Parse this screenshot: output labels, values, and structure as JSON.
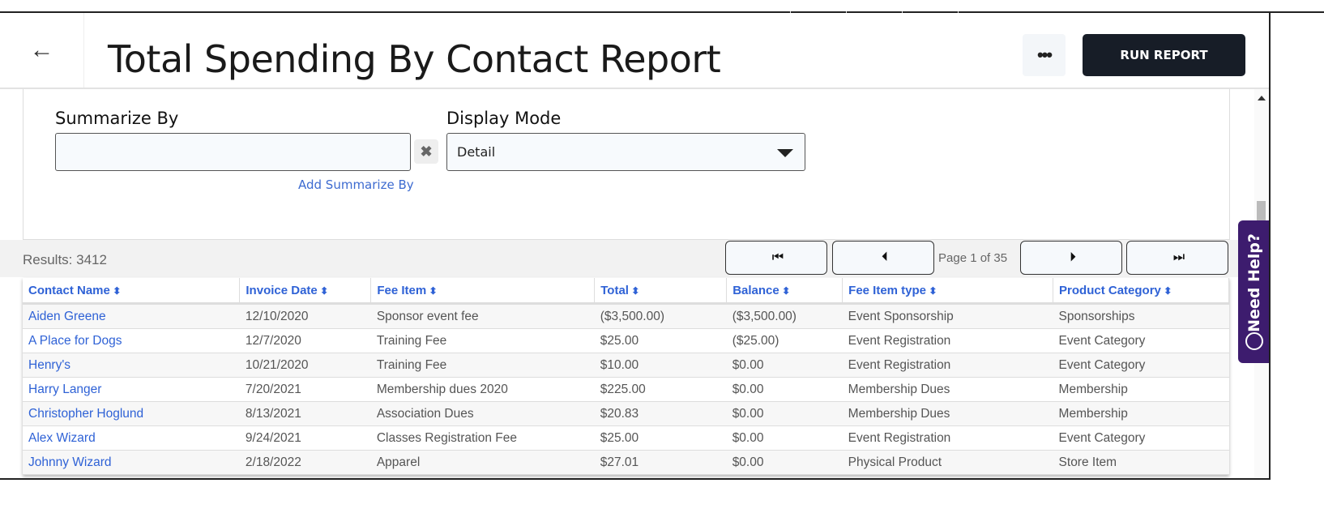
{
  "header": {
    "title": "Total Spending By Contact Report",
    "run_label": "RUN REPORT",
    "more_label": "•••",
    "back_icon": "←"
  },
  "form": {
    "summarize_label": "Summarize By",
    "summarize_value": "",
    "clear_icon": "✖",
    "add_summarize": "Add Summarize By",
    "display_label": "Display Mode",
    "display_value": "Detail"
  },
  "results": {
    "text": "Results: 3412",
    "page_info": "Page 1 of 35",
    "first": "⏮",
    "prev": "⏴",
    "next": "⏵",
    "last": "⏭"
  },
  "help": {
    "label": "Need Help?"
  },
  "table": {
    "columns": [
      "Contact Name",
      "Invoice Date",
      "Fee Item",
      "Total",
      "Balance",
      "Fee Item type",
      "Product Category"
    ],
    "rows": [
      [
        "Aiden Greene",
        "12/10/2020",
        "Sponsor event fee",
        "($3,500.00)",
        "($3,500.00)",
        "Event Sponsorship",
        "Sponsorships"
      ],
      [
        "A Place for Dogs",
        "12/7/2020",
        "Training Fee",
        "$25.00",
        "($25.00)",
        "Event Registration",
        "Event Category"
      ],
      [
        "Henry's",
        "10/21/2020",
        "Training Fee",
        "$10.00",
        "$0.00",
        "Event Registration",
        "Event Category"
      ],
      [
        "Harry Langer",
        "7/20/2021",
        "Membership dues 2020",
        "$225.00",
        "$0.00",
        "Membership Dues",
        "Membership"
      ],
      [
        "Christopher Hoglund",
        "8/13/2021",
        "Association Dues",
        "$20.83",
        "$0.00",
        "Membership Dues",
        "Membership"
      ],
      [
        "Alex Wizard",
        "9/24/2021",
        "Classes Registration Fee",
        "$25.00",
        "$0.00",
        "Event Registration",
        "Event Category"
      ],
      [
        "Johnny Wizard",
        "2/18/2022",
        "Apparel",
        "$27.01",
        "$0.00",
        "Physical Product",
        "Store Item"
      ]
    ]
  }
}
